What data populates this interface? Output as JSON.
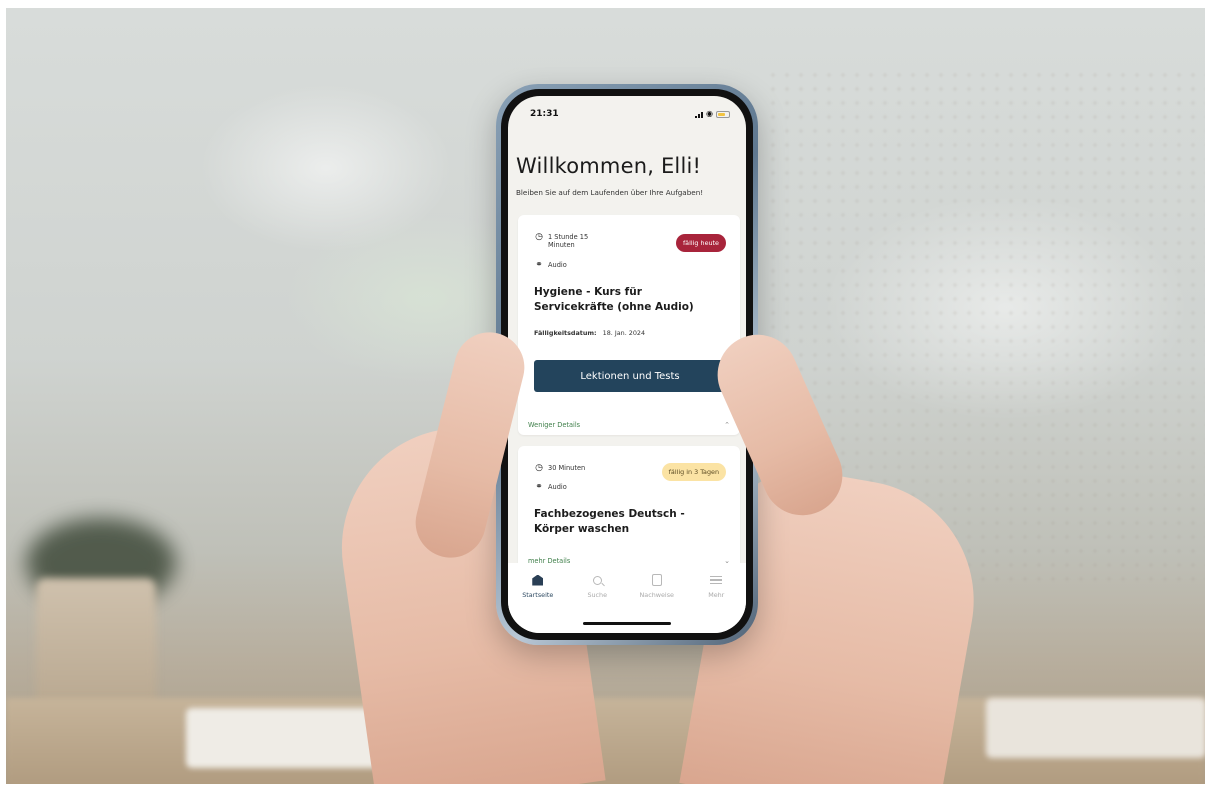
{
  "status_bar": {
    "time": "21:31"
  },
  "header": {
    "title": "Willkommen, Elli!",
    "subtitle": "Bleiben Sie auf dem Laufenden über Ihre Aufgaben!"
  },
  "courses": [
    {
      "duration": "1 Stunde 15 Minuten",
      "duration_line1": "1 Stunde 15",
      "duration_line2": "Minuten",
      "media": "Audio",
      "badge": "fällig heute",
      "badge_color": "#a8243b",
      "title": "Hygiene - Kurs für Servicekräfte (ohne Audio)",
      "due_label": "Fälligkeitsdatum:",
      "due_date": "18. Jan. 2024",
      "action_label": "Lektionen und Tests",
      "details_toggle": "Weniger Details"
    },
    {
      "duration": "30 Minuten",
      "media": "Audio",
      "badge": "fällig in 3 Tagen",
      "badge_color": "#fbe3a4",
      "title": "Fachbezogenes Deutsch - Körper waschen",
      "details_toggle": "mehr Details"
    }
  ],
  "bottom_nav": {
    "items": [
      {
        "label": "Startseite",
        "icon": "home-icon",
        "active": true
      },
      {
        "label": "Suche",
        "icon": "search-icon",
        "active": false
      },
      {
        "label": "Nachweise",
        "icon": "document-icon",
        "active": false
      },
      {
        "label": "Mehr",
        "icon": "menu-icon",
        "active": false
      }
    ]
  },
  "colors": {
    "primary": "#23445c",
    "link_green": "#3f7f4a",
    "screen_bg": "#f3f2ee"
  }
}
